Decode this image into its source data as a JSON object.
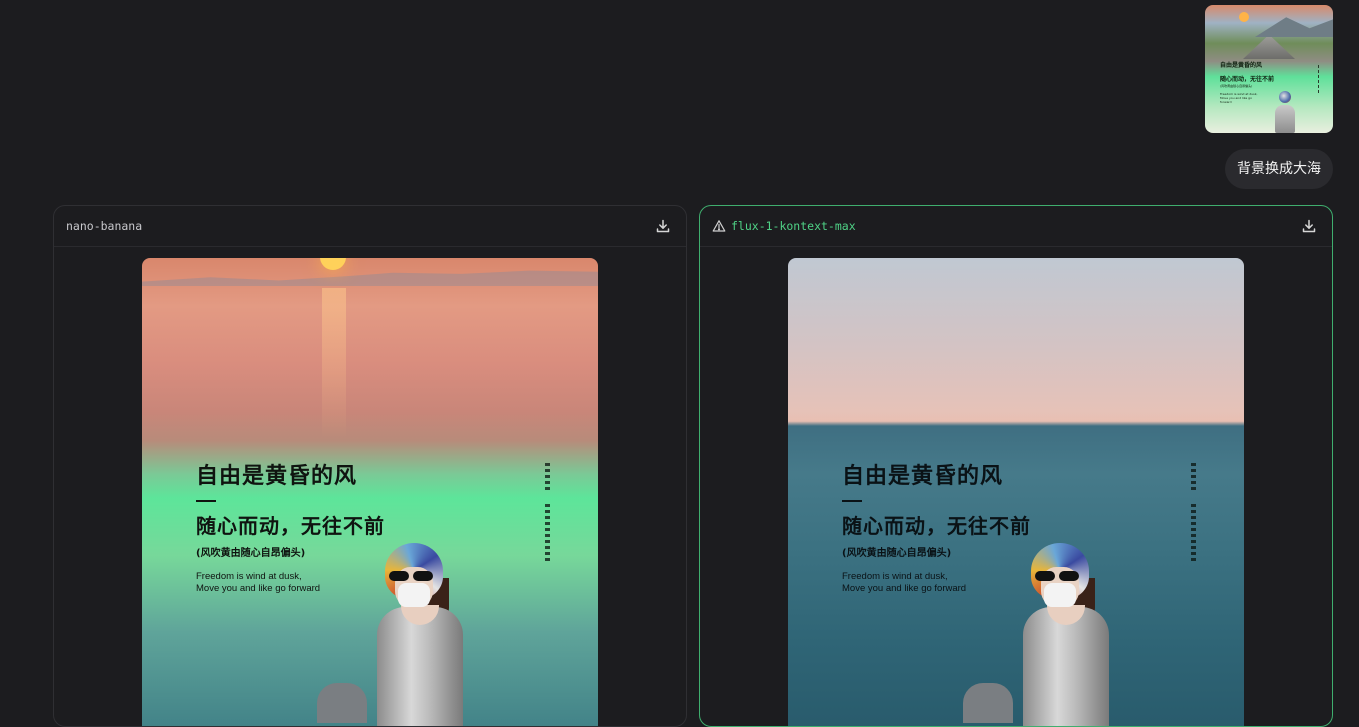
{
  "user_message": {
    "prompt_text": "背景换成大海",
    "thumbnail": {
      "title": "自由是黄昏的风",
      "subtitle": "随心而动，无往不前",
      "note": "(风吹黄由随心自昂偏头)",
      "english": "Freedom is wind at dusk,\nMove you and like go forward"
    }
  },
  "results": [
    {
      "model": "nano-banana",
      "selected": false,
      "warning": false,
      "download_icon": "download-icon",
      "poster": {
        "title": "自由是黄昏的风",
        "subtitle": "随心而动，无往不前",
        "note": "(风吹黄由随心自昂偏头)",
        "english": "Freedom is wind at dusk,\nMove you and like go forward"
      }
    },
    {
      "model": "flux-1-kontext-max",
      "selected": true,
      "warning": true,
      "warning_icon": "warning-triangle-icon",
      "download_icon": "download-icon",
      "poster": {
        "title": "自由是黄昏的风",
        "subtitle": "随心而动，无往不前",
        "note": "(风吹黄由随心自昂偏头)",
        "english": "Freedom is wind at dusk,\nMove you and like go forward"
      }
    }
  ],
  "colors": {
    "background": "#1c1c1f",
    "selected_border": "#3fae6e",
    "selected_model_text": "#4fd286"
  }
}
